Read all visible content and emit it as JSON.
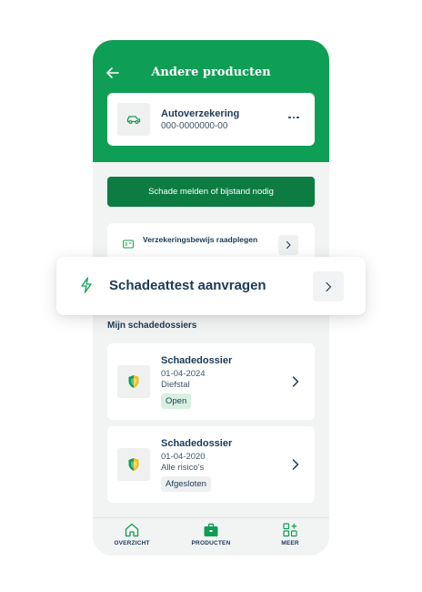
{
  "header": {
    "title": "Andere producten",
    "color": "#0f9e55"
  },
  "product": {
    "name": "Autoverzekering",
    "number": "000-0000000-00",
    "icon": "car-icon"
  },
  "actions": {
    "report_damage_label": "Schade melden of bijstand nodig",
    "report_damage_color": "#0d7c43"
  },
  "menu_items": [
    {
      "label": "Verzekeringsbewijs raadplegen",
      "icon": "id-card-icon"
    },
    {
      "label": "Schadeattest aanvragen",
      "icon": "lightning-icon"
    }
  ],
  "dossiers_section": {
    "title": "Mijn schadedossiers",
    "items": [
      {
        "title": "Schadedossier",
        "date": "01-04-2024",
        "type": "Diefstal",
        "status": "Open",
        "icon": "shield-icon"
      },
      {
        "title": "Schadedossier",
        "date": "01-04-2020",
        "type": "Alle risico's",
        "status": "Afgesloten",
        "icon": "shield-icon"
      }
    ]
  },
  "tabbar": {
    "tabs": [
      {
        "label": "OVERZICHT",
        "icon": "home-icon"
      },
      {
        "label": "PRODUCTEN",
        "icon": "briefcase-icon",
        "active": true
      },
      {
        "label": "MEER",
        "icon": "grid-plus-icon"
      }
    ]
  }
}
